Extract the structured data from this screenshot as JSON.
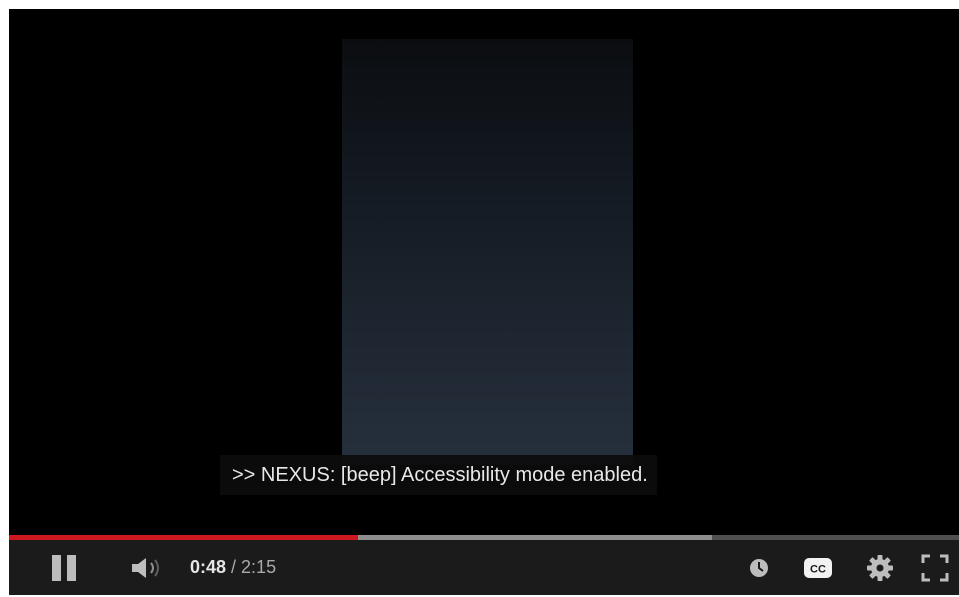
{
  "player": {
    "caption_text": ">> NEXUS: [beep] Accessibility mode enabled.",
    "progress": {
      "played_fraction": 0.367,
      "loaded_fraction": 0.74,
      "played_color": "#cc181e",
      "loaded_color": "#8e8e8e",
      "track_color": "#505050"
    },
    "controls": {
      "play_state": "playing",
      "pause_icon": "pause-icon",
      "volume_icon": "volume-icon",
      "time_current": "0:48",
      "time_separator": " / ",
      "time_total": "2:15",
      "watch_later_icon": "clock-icon",
      "captions_label": "CC",
      "captions_icon": "closed-captions-icon",
      "settings_icon": "gear-icon",
      "fullscreen_icon": "fullscreen-icon"
    }
  }
}
